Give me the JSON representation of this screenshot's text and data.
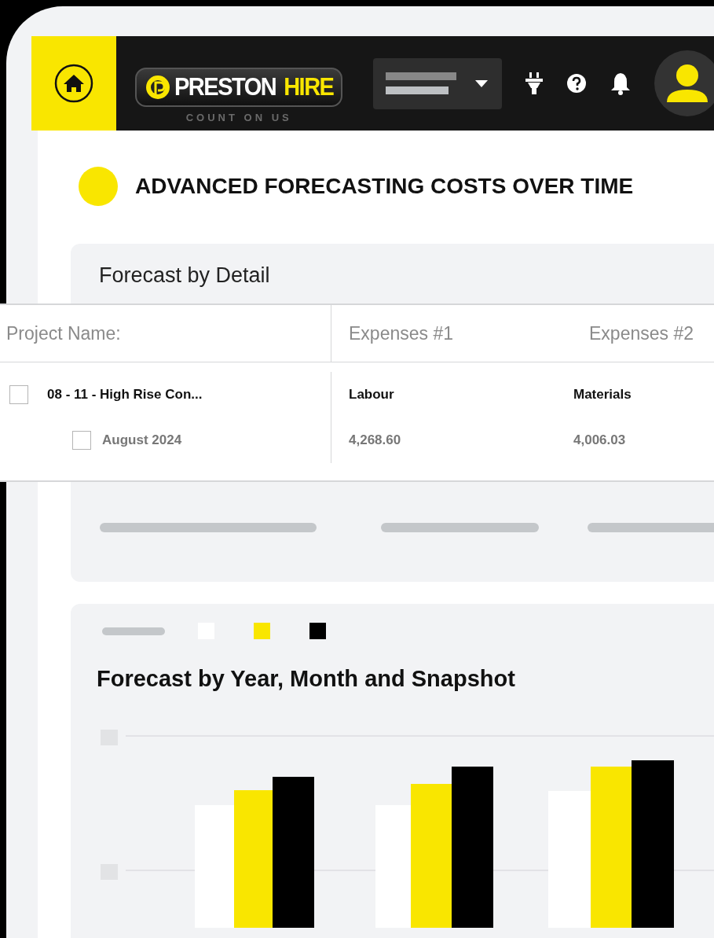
{
  "header": {
    "logo": {
      "name_part_1": "PRESTON",
      "name_part_2": "HIRE",
      "tagline": "COUNT ON US"
    }
  },
  "page_title": "ADVANCED FORECASTING COSTS OVER TIME",
  "detail_card": {
    "title": "Forecast by Detail",
    "table": {
      "columns": [
        "Project Name:",
        "Expenses #1",
        "Expenses #2"
      ],
      "rows": [
        {
          "kind": "project",
          "checked": false,
          "cells": [
            "08 - 11 - High Rise Con...",
            "Labour",
            "Materials"
          ]
        },
        {
          "kind": "period",
          "checked": false,
          "cells": [
            "August 2024",
            "4,268.60",
            "4,006.03"
          ]
        }
      ]
    }
  },
  "chart_card": {
    "title": "Forecast by Year, Month and Snapshot",
    "legend": [
      {
        "color": "#ffffff"
      },
      {
        "color": "#f9e600"
      },
      {
        "color": "#000000"
      }
    ]
  }
}
